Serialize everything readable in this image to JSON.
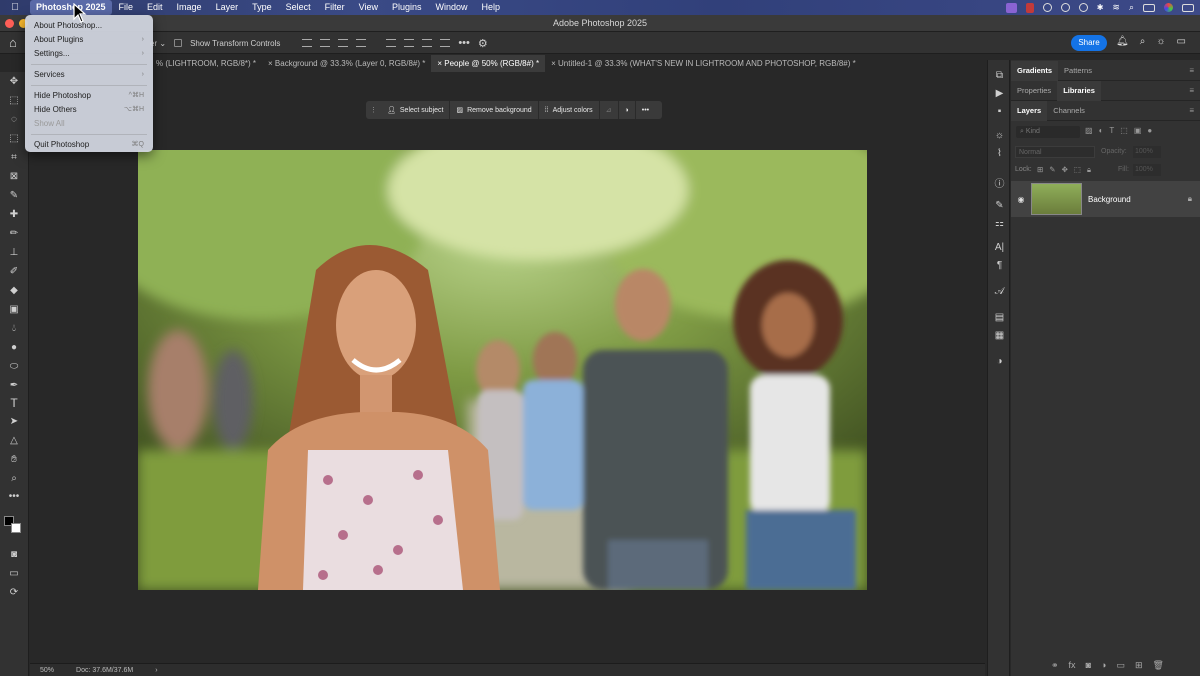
{
  "menubar": {
    "apple": "",
    "items": [
      "Photoshop 2025",
      "File",
      "Edit",
      "Image",
      "Layer",
      "Type",
      "Select",
      "Filter",
      "View",
      "Plugins",
      "Window",
      "Help"
    ]
  },
  "window": {
    "title": "Adobe Photoshop 2025"
  },
  "dropdown": {
    "about": "About Photoshop...",
    "plugins": "About Plugins",
    "settings": "Settings...",
    "services": "Services",
    "hide": "Hide Photoshop",
    "hide_sc": "^⌘H",
    "hide_others": "Hide Others",
    "hide_others_sc": "⌥⌘H",
    "show_all": "Show All",
    "quit": "Quit Photoshop",
    "quit_sc": "⌘Q"
  },
  "options": {
    "partial": "er",
    "transform": "Show Transform Controls",
    "share": "Share"
  },
  "tabs": [
    "% (LIGHTROOM, RGB/8*) *",
    "Background @ 33.3% (Layer 0, RGB/8#) *",
    "People @ 50% (RGB/8#) *",
    "Untitled-1 @ 33.3% (WHAT'S NEW IN LIGHTROOM AND PHOTOSHOP, RGB/8#) *"
  ],
  "contextbar": {
    "select_subject": "Select subject",
    "remove_background": "Remove background",
    "adjust_colors": "Adjust colors"
  },
  "status": {
    "zoom": "50%",
    "doc": "Doc: 37.6M/37.6M",
    "arrow": "›"
  },
  "panels": {
    "tabs1": [
      "Gradients",
      "Patterns"
    ],
    "tabs2": [
      "Properties",
      "Libraries"
    ],
    "tabs3": [
      "Layers",
      "Channels"
    ],
    "kind": "Kind",
    "blend": "Normal",
    "opacity_label": "Opacity:",
    "opacity_val": "100%",
    "lock_label": "Lock:",
    "fill_label": "Fill:",
    "fill_val": "100%",
    "layer_name": "Background"
  },
  "colors": {
    "accent": "#1473e6",
    "menubar": "#34427a"
  }
}
